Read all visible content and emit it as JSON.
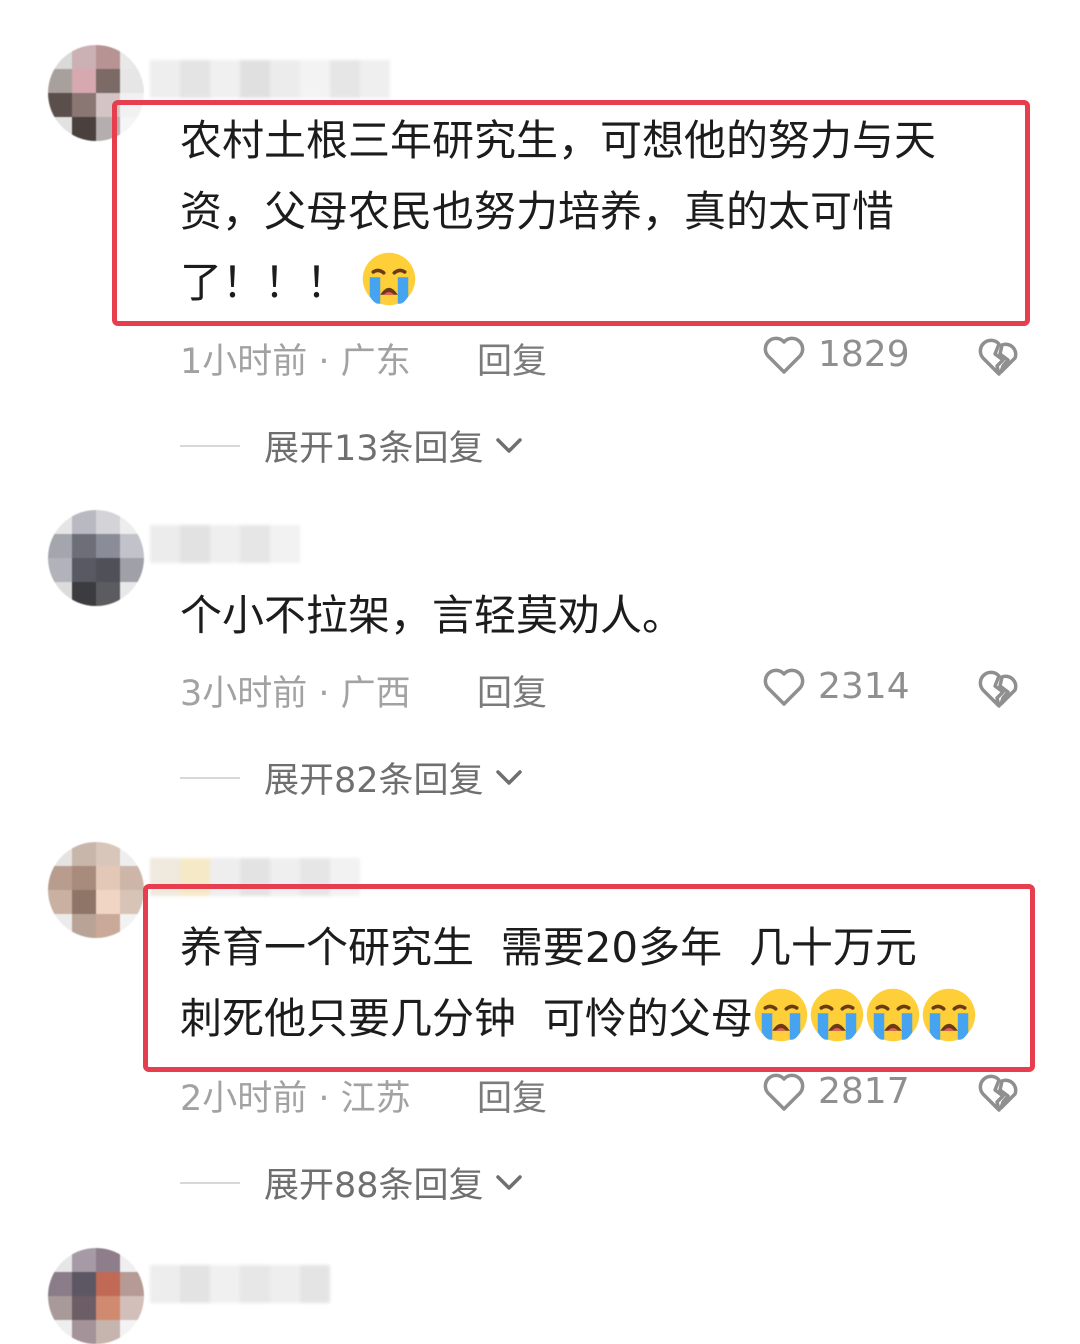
{
  "comments": [
    {
      "lines": [
        "农村土根三年研究生，可想他的努力与天",
        "资，父母农民也努力培养，真的太可惜",
        "了！！！"
      ],
      "time": "1小时前 · 广东",
      "reply_label": "回复",
      "likes": "1829",
      "expand": "展开13条回复"
    },
    {
      "lines": [
        "个小不拉架，言轻莫劝人。"
      ],
      "time": "3小时前 · 广西",
      "reply_label": "回复",
      "likes": "2314",
      "expand": "展开82条回复"
    },
    {
      "lines": [
        "养育一个研究生  需要20多年  几十万元",
        "刺死他只要几分钟  可怜的父母"
      ],
      "time": "2小时前 · 江苏",
      "reply_label": "回复",
      "likes": "2817",
      "expand": "展开88条回复"
    }
  ],
  "highlight_color": "#e63e4e"
}
